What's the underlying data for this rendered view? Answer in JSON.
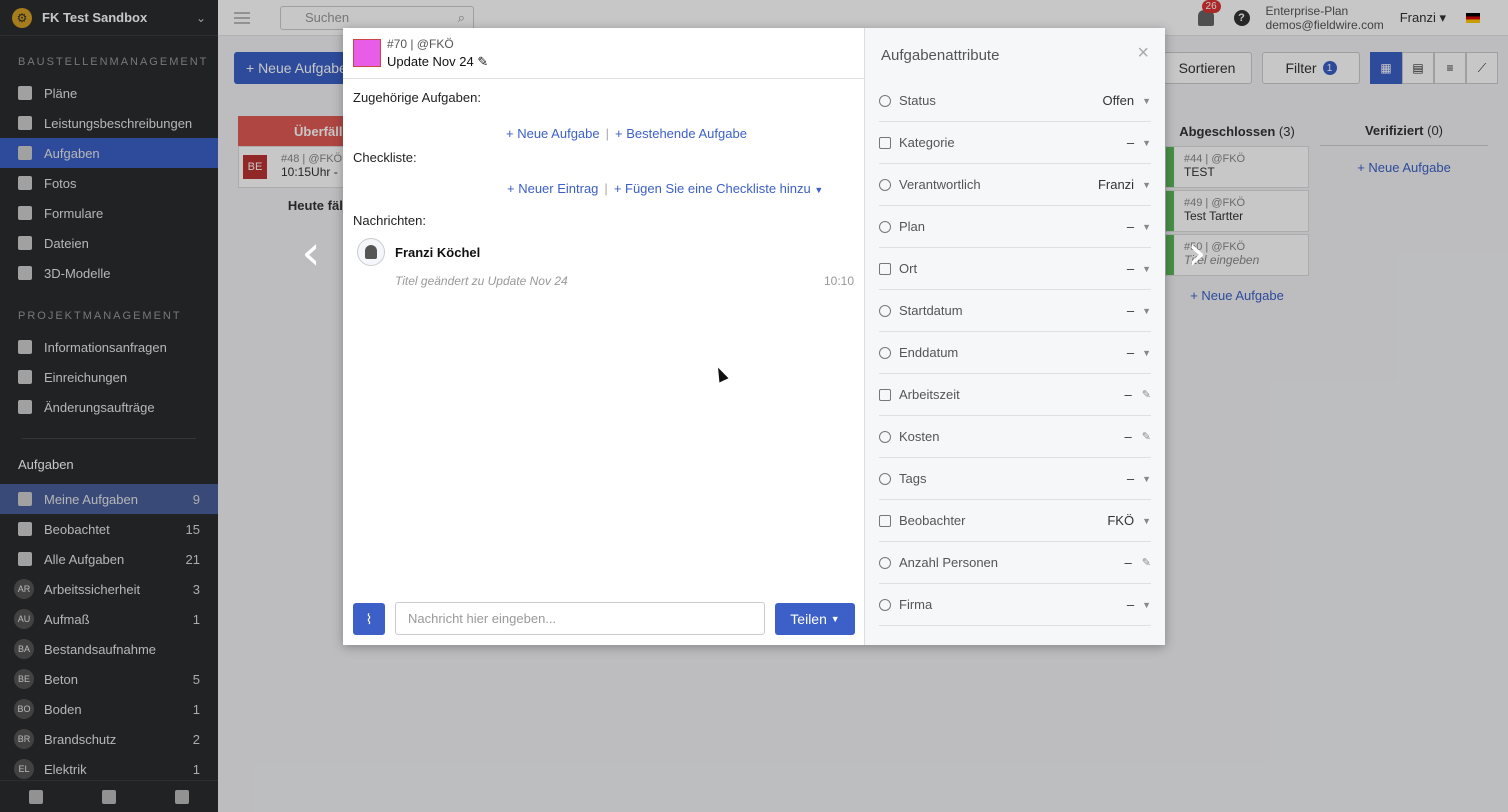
{
  "sidebar": {
    "project": "FK Test Sandbox",
    "section1": "BAUSTELLENMANAGEMENT",
    "items1": [
      "Pläne",
      "Leistungsbeschreibungen",
      "Aufgaben",
      "Fotos",
      "Formulare",
      "Dateien",
      "3D-Modelle"
    ],
    "section2": "PROJEKTMANAGEMENT",
    "items2": [
      "Informationsanfragen",
      "Einreichungen",
      "Änderungsaufträge"
    ],
    "tasks_heading": "Aufgaben",
    "task_filters": [
      {
        "label": "Meine Aufgaben",
        "count": "9"
      },
      {
        "label": "Beobachtet",
        "count": "15"
      },
      {
        "label": "Alle Aufgaben",
        "count": "21"
      }
    ],
    "categories": [
      {
        "abbr": "AR",
        "label": "Arbeitssicherheit",
        "count": "3"
      },
      {
        "abbr": "AU",
        "label": "Aufmaß",
        "count": "1"
      },
      {
        "abbr": "BA",
        "label": "Bestandsaufnahme",
        "count": ""
      },
      {
        "abbr": "BE",
        "label": "Beton",
        "count": "5"
      },
      {
        "abbr": "BO",
        "label": "Boden",
        "count": "1"
      },
      {
        "abbr": "BR",
        "label": "Brandschutz",
        "count": "2"
      },
      {
        "abbr": "EL",
        "label": "Elektrik",
        "count": "1"
      }
    ]
  },
  "topbar": {
    "search_placeholder": "Suchen",
    "notifications": "26",
    "plan_name": "Enterprise-Plan",
    "plan_email": "demos@fieldwire.com",
    "user": "Franzi"
  },
  "board": {
    "new_task": "+ Neue Aufgabe",
    "sort": "Sortieren",
    "filter": "Filter",
    "filter_count": "1",
    "overdue": "Überfällig",
    "overdue_card_badge": "BE",
    "overdue_card_meta": "#48 | @FKÖ",
    "overdue_card_title": "10:15Uhr -",
    "today": "Heute fällig",
    "done_title": "Abgeschlossen",
    "done_count": "(3)",
    "verified_title": "Verifiziert",
    "verified_count": "(0)",
    "done_cards": [
      {
        "meta": "#44 | @FKÖ",
        "title": "TEST"
      },
      {
        "meta": "#49 | @FKÖ",
        "title": "Test Tartter"
      },
      {
        "meta": "#50 | @FKÖ",
        "title": "Titel eingeben"
      }
    ],
    "add_task": "+ Neue Aufgabe"
  },
  "modal": {
    "task_meta": "#70 | @FKÖ",
    "task_title": "Update Nov 24",
    "related_label": "Zugehörige Aufgaben:",
    "new_task_link": "+ Neue Aufgabe",
    "existing_task_link": "+ Bestehende Aufgabe",
    "checklist_label": "Checkliste:",
    "new_entry_link": "+ Neuer Eintrag",
    "add_checklist_link": "+ Fügen Sie eine Checkliste hinzu",
    "messages_label": "Nachrichten:",
    "message_author": "Franzi Köchel",
    "message_text": "Titel geändert zu Update Nov 24",
    "message_time": "10:10",
    "input_placeholder": "Nachricht hier eingeben...",
    "share_button": "Teilen",
    "attributes_title": "Aufgabenattribute",
    "attributes": [
      {
        "label": "Status",
        "value": "Offen",
        "ctl": "dd"
      },
      {
        "label": "Kategorie",
        "value": "–",
        "ctl": "dd"
      },
      {
        "label": "Verantwortlich",
        "value": "Franzi",
        "ctl": "dd"
      },
      {
        "label": "Plan",
        "value": "–",
        "ctl": "dd"
      },
      {
        "label": "Ort",
        "value": "–",
        "ctl": "dd"
      },
      {
        "label": "Startdatum",
        "value": "–",
        "ctl": "dd"
      },
      {
        "label": "Enddatum",
        "value": "–",
        "ctl": "dd"
      },
      {
        "label": "Arbeitszeit",
        "value": "–",
        "ctl": "pen"
      },
      {
        "label": "Kosten",
        "value": "–",
        "ctl": "pen"
      },
      {
        "label": "Tags",
        "value": "–",
        "ctl": "dd"
      },
      {
        "label": "Beobachter",
        "value": "FKÖ",
        "ctl": "dd"
      },
      {
        "label": "Anzahl Personen",
        "value": "–",
        "ctl": "pen"
      },
      {
        "label": "Firma",
        "value": "–",
        "ctl": "dd"
      }
    ]
  }
}
